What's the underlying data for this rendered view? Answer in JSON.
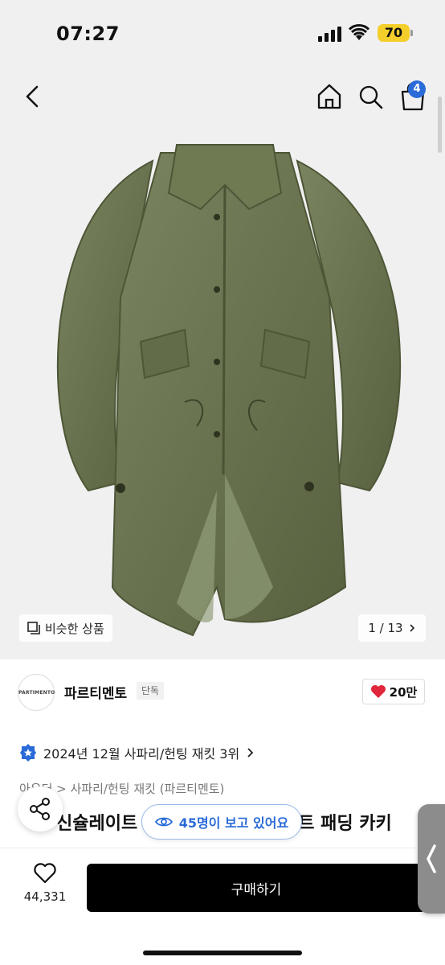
{
  "status_bar": {
    "time": "07:27",
    "battery": "70"
  },
  "nav": {
    "cart_count": "4"
  },
  "image": {
    "similar_label": "비슷한 상품",
    "page_current": "1",
    "page_total": "13",
    "page_text": "1 / 13"
  },
  "brand": {
    "logo_text": "PARTIMENTO",
    "name": "파르티멘토",
    "tag": "단독",
    "likes": "20만"
  },
  "ranking": {
    "text": "2024년 12월 사파리/헌팅 재킷 3위"
  },
  "category": {
    "text": "아우터 > 사파리/헌팅 재킷 (파르티멘토)"
  },
  "title": {
    "text": "신슐레이트 피쉬테일 롱 야상 코트 패딩 카키",
    "visible_left": "신슐레이트",
    "visible_right": "트 패딩 카키"
  },
  "viewers": {
    "text": "45명이 보고 있어요"
  },
  "bottom": {
    "wish_count": "44,331",
    "buy_label": "구매하기"
  },
  "colors": {
    "accent": "#2a6bd8",
    "coat": "#66704e",
    "buy": "#000000",
    "like": "#e0263b"
  },
  "icons": [
    "back-icon",
    "home-icon",
    "search-icon",
    "bag-icon",
    "similar-icon",
    "chevron-right-icon",
    "heart-icon",
    "rank-badge-icon",
    "share-icon",
    "eye-icon",
    "chevron-left-icon"
  ]
}
